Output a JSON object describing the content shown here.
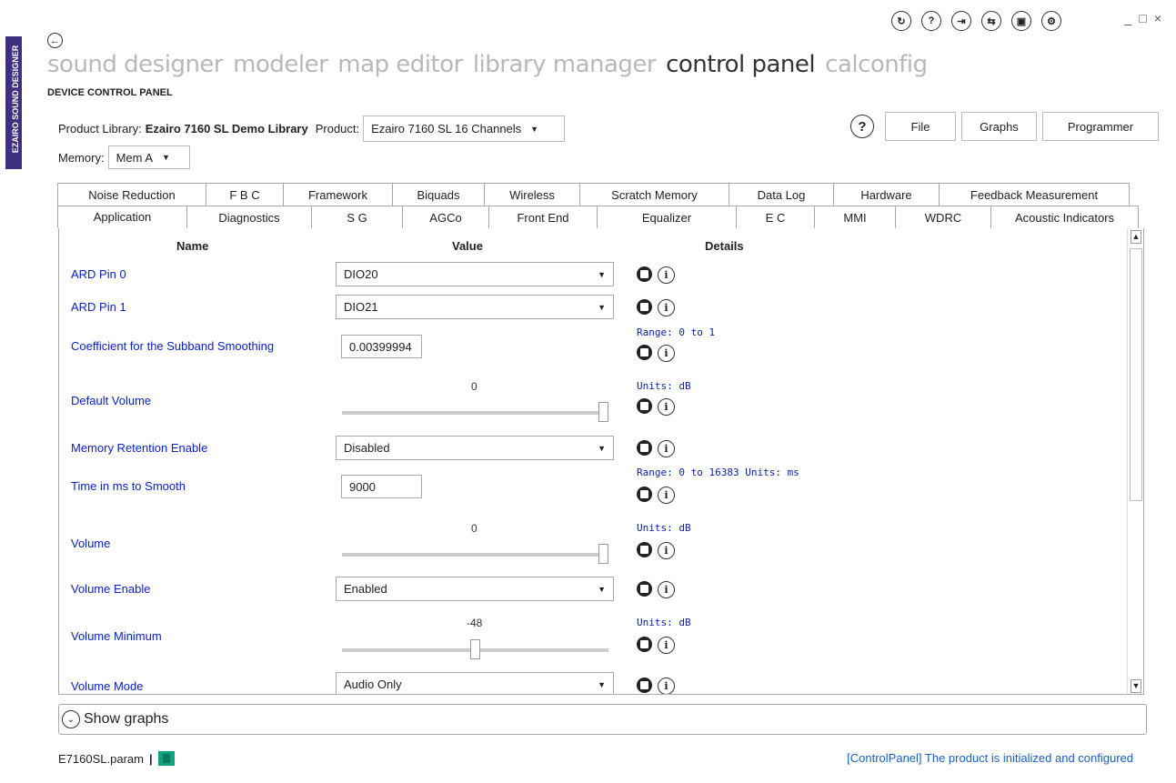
{
  "brand": {
    "vertical_label": "EZAIRO SOUND DESIGNER"
  },
  "window": {
    "controls": [
      "_",
      "□",
      "×"
    ]
  },
  "top_icons": [
    "refresh-icon",
    "help-circle-icon",
    "import-icon",
    "sync-icon",
    "terminal-icon",
    "settings-icon"
  ],
  "top_icon_glyphs": [
    "↻",
    "?",
    "⇥",
    "⇆",
    "▣",
    "⚙"
  ],
  "nav": {
    "items": [
      "sound designer",
      "modeler",
      "map editor",
      "library manager",
      "control panel",
      "calconfig"
    ],
    "active": "control panel"
  },
  "panel_title": "DEVICE CONTROL PANEL",
  "toolbar": {
    "library_label": "Product Library:",
    "library_value": "Ezairo 7160 SL Demo Library",
    "product_label": "Product:",
    "product_value": "Ezairo 7160 SL 16 Channels",
    "help": "?",
    "file_button": "File",
    "graphs_button": "Graphs",
    "programmer_button": "Programmer"
  },
  "memory": {
    "label": "Memory:",
    "value": "Mem A"
  },
  "tabs_row1": [
    "Noise Reduction",
    "F B C",
    "Framework",
    "Biquads",
    "Wireless",
    "Scratch Memory",
    "Data Log",
    "Hardware",
    "Feedback Measurement"
  ],
  "tabs_row2": [
    "Application",
    "Diagnostics",
    "S G",
    "AGCo",
    "Front End",
    "Equalizer",
    "E C",
    "MMI",
    "WDRC",
    "Acoustic Indicators"
  ],
  "active_tab": "Application",
  "columns": {
    "name": "Name",
    "value": "Value",
    "details": "Details"
  },
  "rows": {
    "ard_pin0": {
      "name": "ARD Pin 0",
      "value": "DIO20"
    },
    "ard_pin1": {
      "name": "ARD Pin 1",
      "value": "DIO21"
    },
    "coeff": {
      "name": "Coefficient for the Subband Smoothing",
      "value": "0.00399994",
      "detail": "Range:  0  to  1"
    },
    "default_volume": {
      "name": "Default Volume",
      "value": "0",
      "detail": "Units:  dB",
      "level": 1.0
    },
    "mem_retention": {
      "name": "Memory Retention Enable",
      "value": "Disabled"
    },
    "time_smooth": {
      "name": "Time in ms to Smooth",
      "value": "9000",
      "detail": "Range:  0  to  16383  Units:  ms"
    },
    "volume": {
      "name": "Volume",
      "value": "0",
      "detail": "Units:  dB",
      "level": 1.0
    },
    "volume_enable": {
      "name": "Volume Enable",
      "value": "Enabled"
    },
    "volume_min": {
      "name": "Volume Minimum",
      "value": "-48",
      "detail": "Units:  dB",
      "level": 0.5
    },
    "volume_mode": {
      "name": "Volume Mode",
      "value": "Audio Only"
    }
  },
  "show_graphs": "Show graphs",
  "footer": {
    "file": "E7160SL.param",
    "separator": "|",
    "status": "[ControlPanel] The product is initialized and configured"
  }
}
